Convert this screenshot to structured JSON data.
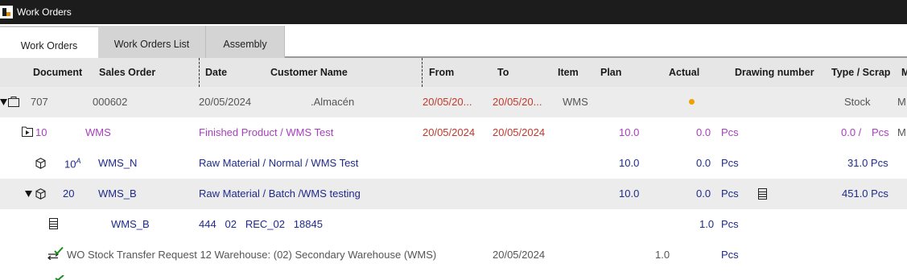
{
  "window": {
    "title": "Work Orders"
  },
  "tabs": [
    {
      "label": "Work Orders"
    },
    {
      "label": "Work Orders List"
    },
    {
      "label": "Assembly"
    }
  ],
  "columns": {
    "document": "Document",
    "sales_order": "Sales Order",
    "date": "Date",
    "customer_name": "Customer Name",
    "from": "From",
    "to": "To",
    "item": "Item",
    "plan": "Plan",
    "actual": "Actual",
    "drawing_number": "Drawing number",
    "type_scrap": "Type / Scrap",
    "overflow": "M"
  },
  "rows": {
    "wo": {
      "document": "707",
      "sales_order": "000602",
      "date": "20/05/2024",
      "customer": ".Almacén",
      "from": "20/05/20...",
      "to": "20/05/20...",
      "item": "WMS",
      "type": "Stock",
      "overflow": "M"
    },
    "product": {
      "line": "10",
      "item": "WMS",
      "description": "Finished Product / WMS Test",
      "from": "20/05/2024",
      "to": "20/05/2024",
      "plan": "10.0",
      "actual": "0.0",
      "unit": "Pcs",
      "type_scrap_value": "0.0 /",
      "type_scrap_unit": "Pcs",
      "overflow": "M"
    },
    "raw_normal": {
      "line": "10",
      "line_sup": "A",
      "item": "WMS_N",
      "description": "Raw Material / Normal / WMS Test",
      "plan": "10.0",
      "actual": "0.0",
      "unit": "Pcs",
      "type_scrap_value": "31.0 Pcs"
    },
    "raw_batch": {
      "line": "20",
      "item": "WMS_B",
      "description": "Raw Material / Batch /WMS testing",
      "plan": "10.0",
      "actual": "0.0",
      "unit": "Pcs",
      "type_scrap_value": "451.0 Pcs"
    },
    "batch_detail": {
      "item": "WMS_B",
      "batch_info": "444   02   REC_02   18845",
      "actual": "1.0",
      "unit": "Pcs"
    },
    "transfer": {
      "description": "WO Stock Transfer Request 12 Warehouse: (02) Secondary Warehouse (WMS)",
      "date": "20/05/2024",
      "plan": "1.0",
      "unit": "Pcs"
    }
  },
  "colors": {
    "titlebar": "#1c1c1c",
    "header_bg": "#e6e6e6",
    "date_red": "#c0392b",
    "product_purple": "#a63fbd",
    "material_navy": "#1f2a8a",
    "status_dot": "#f0a000",
    "transfer_check": "#1e8c1e"
  },
  "icons": {
    "logo": "app-logo-icon",
    "folder": "folder-icon",
    "folder_play": "folder-play-icon",
    "cube": "cube-icon",
    "list": "list-icon",
    "transfer": "transfer-arrows-check-icon",
    "expand": "triangle-down-icon"
  }
}
